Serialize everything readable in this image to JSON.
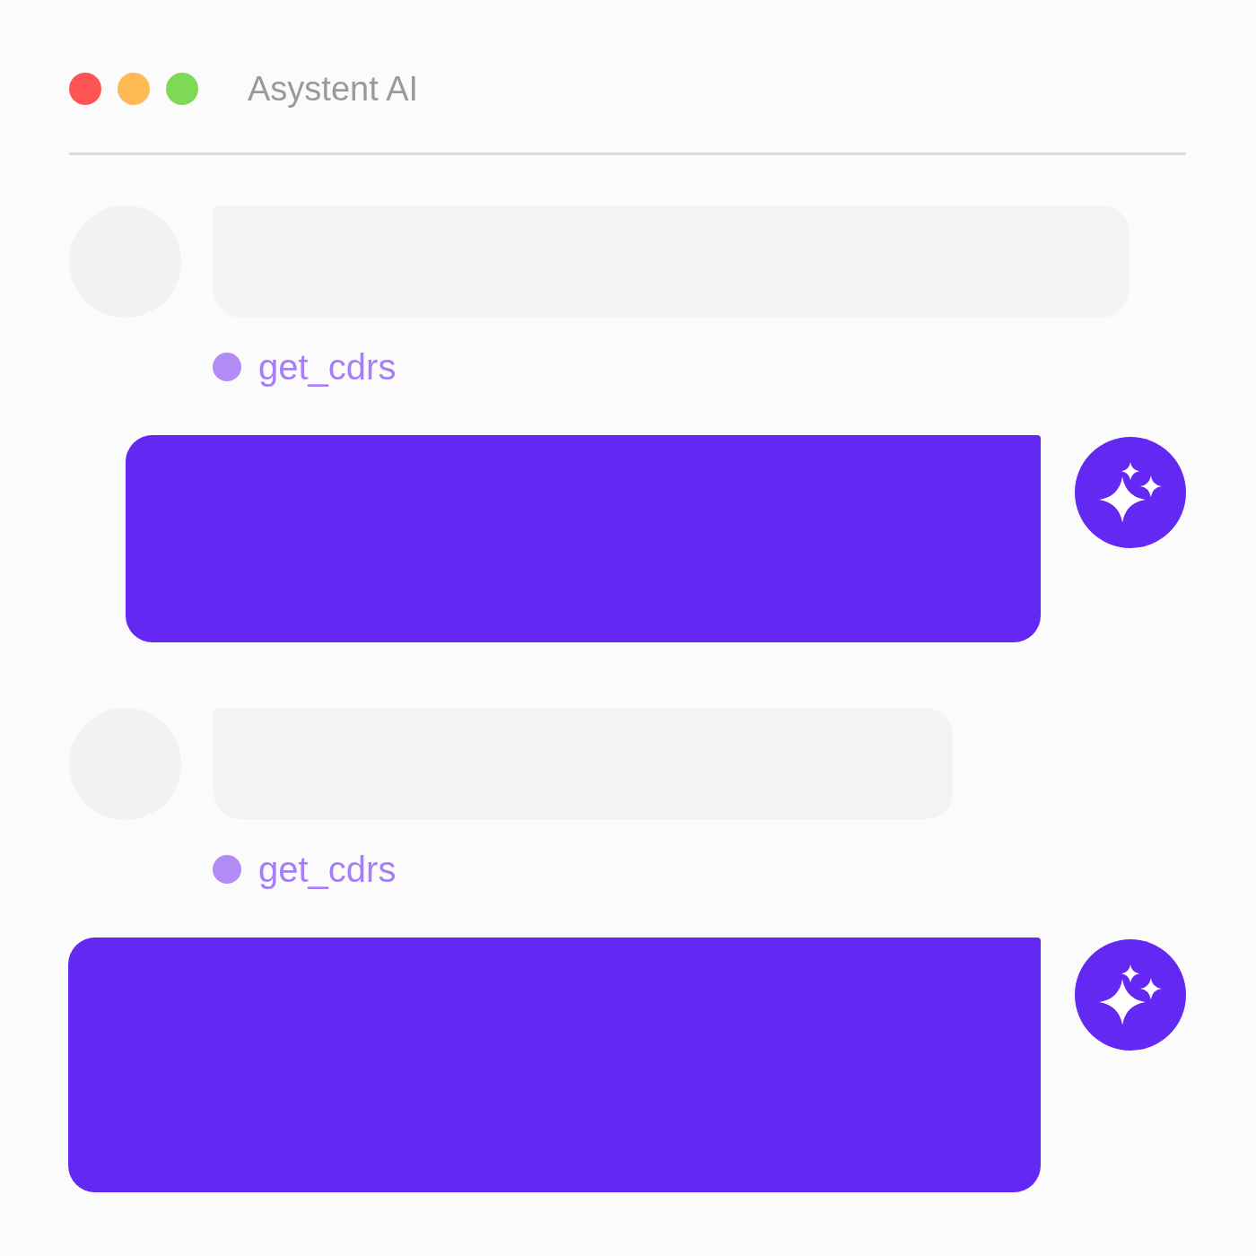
{
  "window": {
    "title": "Asystent AI"
  },
  "messages": [
    {
      "kind": "user"
    },
    {
      "kind": "tool",
      "label": "get_cdrs"
    },
    {
      "kind": "assistant"
    },
    {
      "kind": "user"
    },
    {
      "kind": "tool",
      "label": "get_cdrs"
    },
    {
      "kind": "assistant"
    }
  ]
}
